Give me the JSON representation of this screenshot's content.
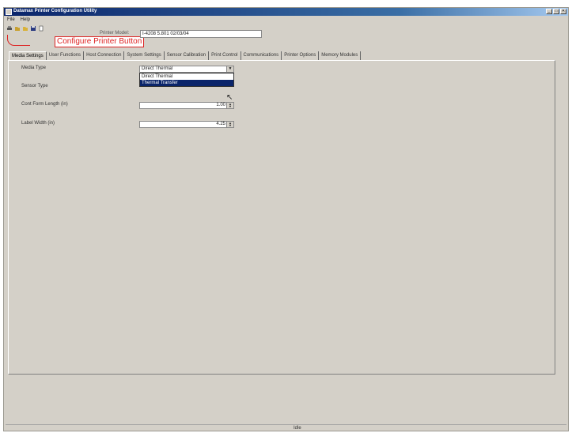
{
  "window": {
    "title": "Datamax Printer Configuration Utility",
    "controls": [
      "_",
      "□",
      "✕"
    ]
  },
  "menubar": [
    "File",
    "Help"
  ],
  "toolbar": {
    "icons": [
      "printer-config-icon",
      "open-folder-icon",
      "folder-icon",
      "save-icon",
      "document-icon"
    ],
    "callout": "Configure Printer Button"
  },
  "printer_model": {
    "label": "Printer Model:",
    "value": "I-4208 5.801 02/03/04"
  },
  "tabs": [
    "Media Settings",
    "User Functions",
    "Host Connection",
    "System Settings",
    "Sensor Calibration",
    "Print Control",
    "Communications",
    "Printer Options",
    "Memory Modules"
  ],
  "active_tab": "Media Settings",
  "media_settings": {
    "media_type_label": "Media Type",
    "media_type_value": "Direct Thermal",
    "media_type_options": [
      "Direct Thermal",
      "Thermal Transfer"
    ],
    "highlighted_option": "Thermal Transfer",
    "sensor_type_label": "Sensor Type",
    "cont_form_label": "Cont Form Length (in)",
    "cont_form_value": "1.00",
    "label_width_label": "Label Width (in)",
    "label_width_value": "4.25"
  },
  "status": "Idle",
  "colors": {
    "titlebar": "#0a246a",
    "selection": "#0a246a",
    "callout": "#dd2222",
    "face": "#d4d0c8"
  }
}
